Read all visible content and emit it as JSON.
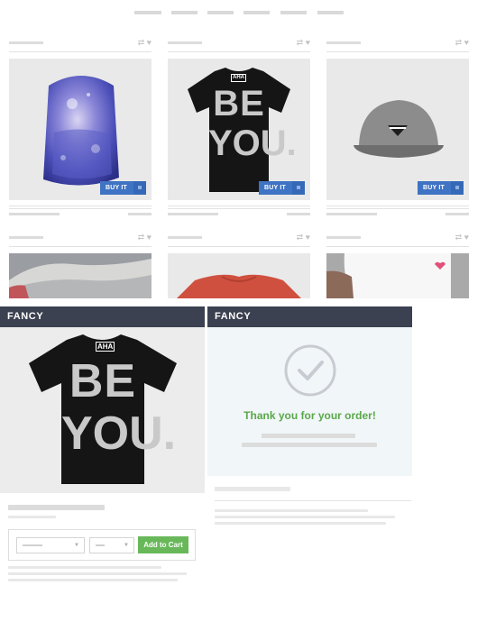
{
  "products": [
    {
      "buy_label": "BUY IT"
    },
    {
      "buy_label": "BUY IT"
    },
    {
      "buy_label": "BUY IT"
    }
  ],
  "shirt": {
    "brand": "AHA",
    "line1": "BE",
    "line2": "YOU."
  },
  "fancy_left": {
    "title": "FANCY"
  },
  "fancy_right": {
    "title": "FANCY",
    "thanks": "Thank you for your order!"
  },
  "cart": {
    "add_label": "Add to Cart"
  },
  "colors": {
    "buy_blue": "#3f73c4",
    "fancy_header": "#3b4150",
    "success_green": "#5aa84a",
    "add_green": "#68b85a"
  },
  "icons": [
    "repost-icon",
    "heart-icon",
    "check-circle-icon",
    "chevron-down-icon"
  ]
}
